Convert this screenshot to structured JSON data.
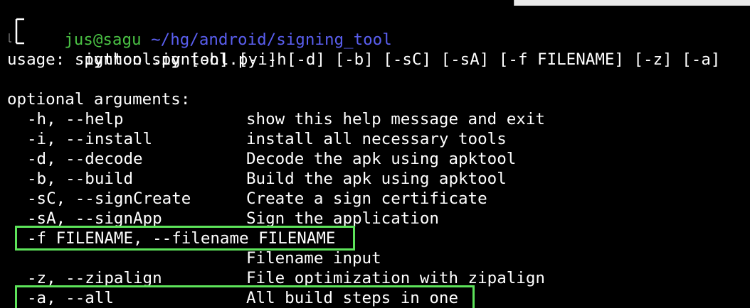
{
  "prompt": {
    "user": "jus@sagu",
    "path": "~/hg/android/signing_tool",
    "command": "python signtool.py -h"
  },
  "output": {
    "usage": "usage: signtool.py [-h] [-i] [-d] [-b] [-sC] [-sA] [-f FILENAME] [-z] [-a]",
    "section_header": "optional arguments:",
    "args": [
      {
        "flag": "-h, --help",
        "desc": "show this help message and exit"
      },
      {
        "flag": "-i, --install",
        "desc": "install all necessary tools"
      },
      {
        "flag": "-d, --decode",
        "desc": "Decode the apk using apktool"
      },
      {
        "flag": "-b, --build",
        "desc": "Build the apk using apktool"
      },
      {
        "flag": "-sC, --signCreate",
        "desc": "Create a sign certificate"
      },
      {
        "flag": "-sA, --signApp",
        "desc": "Sign the application"
      },
      {
        "flag": "-f FILENAME, --filename FILENAME",
        "desc": ""
      },
      {
        "flag": "",
        "desc": "Filename input"
      },
      {
        "flag": "-z, --zipalign",
        "desc": "File optimization with zipalign"
      },
      {
        "flag": "-a, --all",
        "desc": "All build steps in one"
      }
    ]
  },
  "colors": {
    "background": "#000000",
    "text": "#ffffff",
    "prompt_user": "#4ac244",
    "prompt_path": "#5a5ff0",
    "highlight": "#5de35a"
  },
  "highlighted_args": [
    "-f FILENAME, --filename FILENAME",
    "-a, --all"
  ]
}
